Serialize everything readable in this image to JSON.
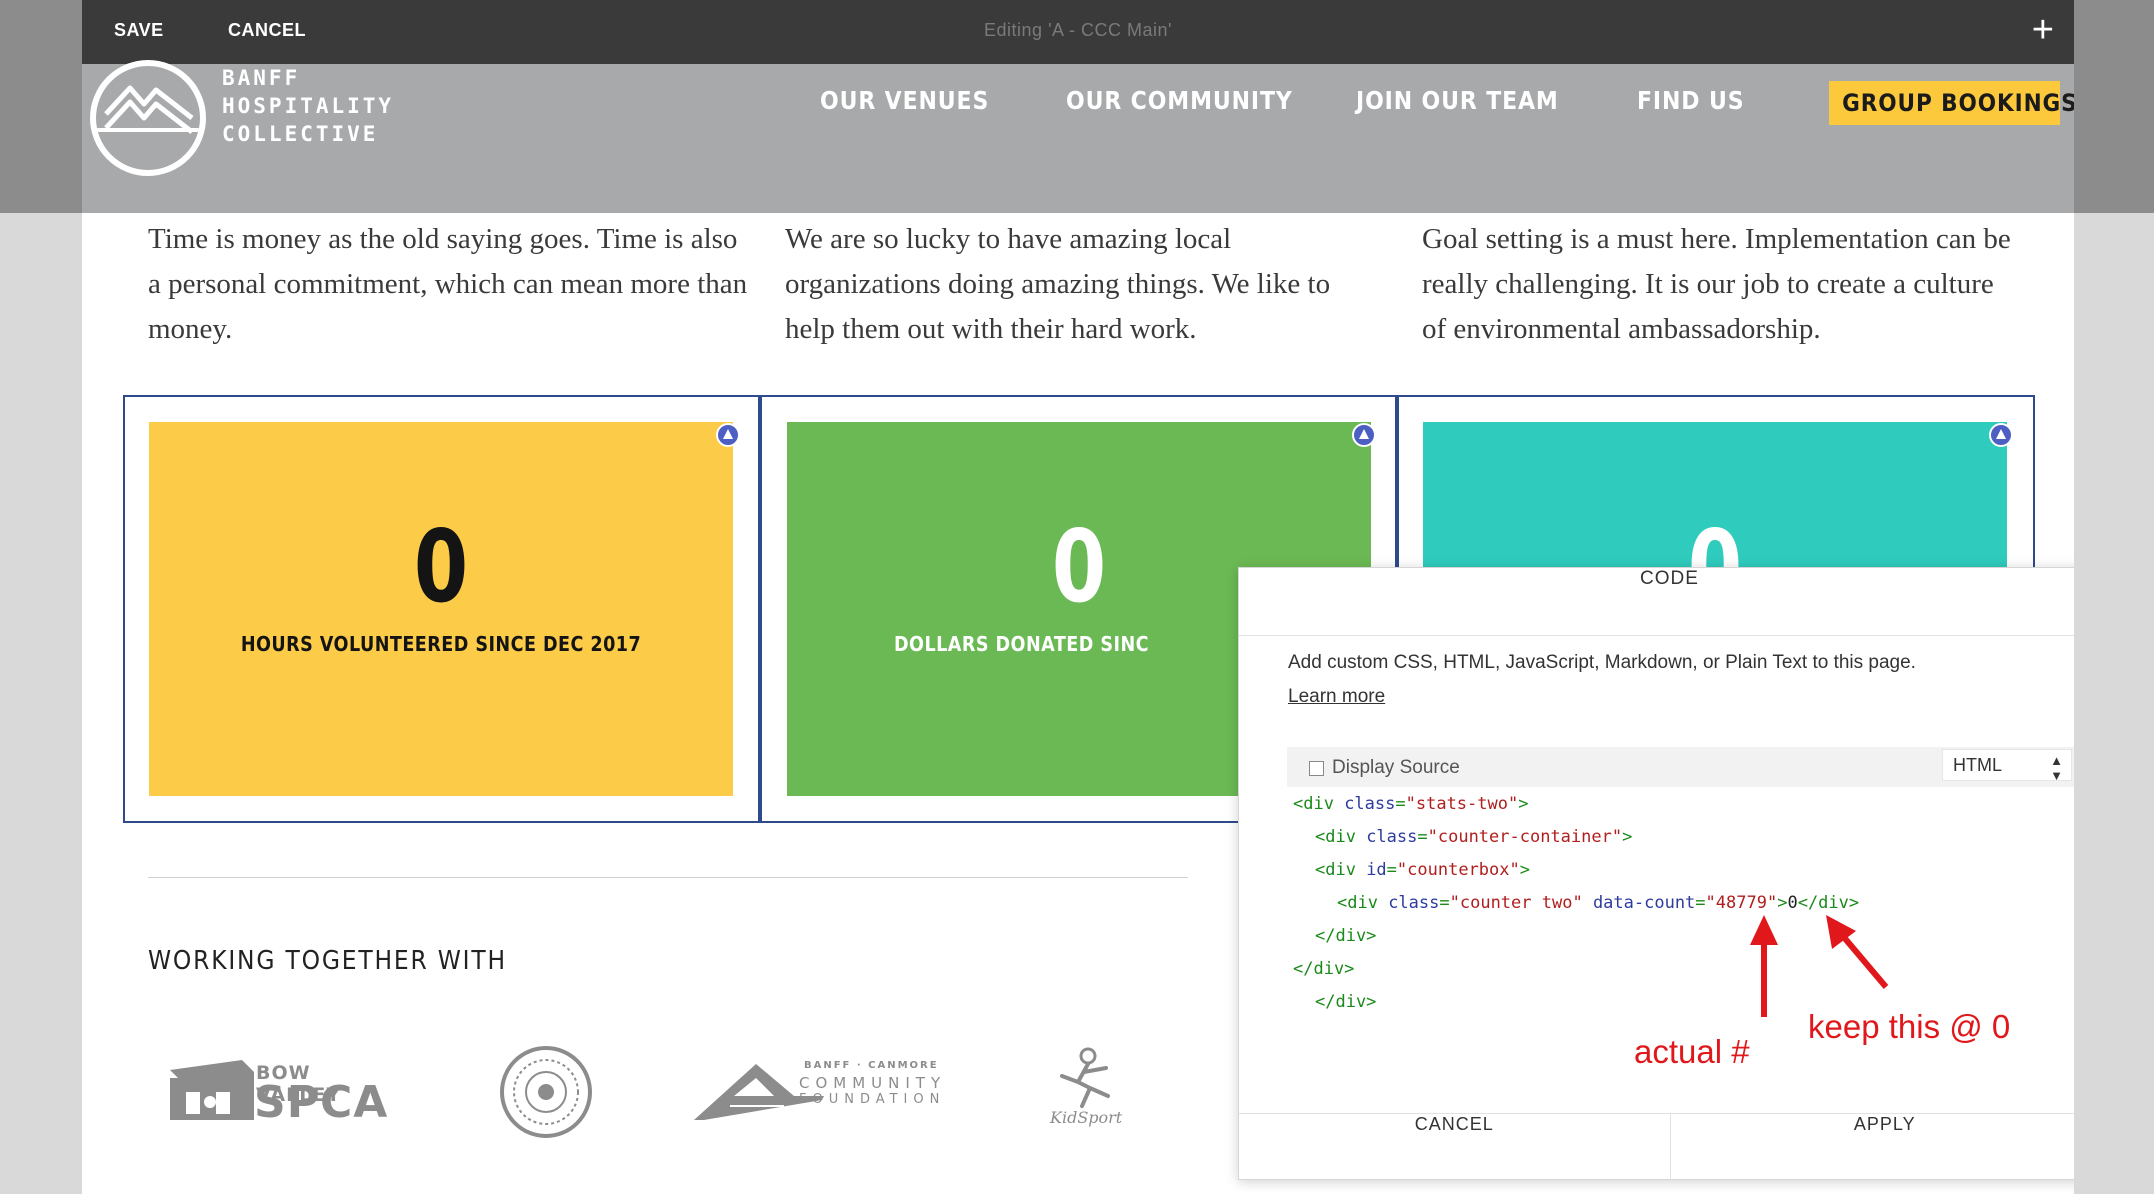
{
  "editor": {
    "save": "SAVE",
    "cancel": "CANCEL",
    "title": "Editing 'A - CCC Main'",
    "add": "+"
  },
  "site": {
    "logo_lines": [
      "BANFF",
      "HOSPITALITY",
      "COLLECTIVE"
    ],
    "nav": [
      "OUR VENUES",
      "OUR COMMUNITY",
      "JOIN OUR TEAM",
      "FIND US"
    ],
    "cta": "GROUP BOOKINGS"
  },
  "columns": [
    "Time is money as the old saying goes. Time is also a personal commitment, which can mean more than money.",
    "We are so lucky to have amazing local organizations doing amazing things. We like to help them out with their hard work.",
    "Goal setting is a must here. Implementation can be really challenging. It is our job to create a culture of environmental ambassadorship."
  ],
  "stats": [
    {
      "value": "0",
      "label": "HOURS VOLUNTEERED SINCE DEC 2017",
      "color": "#fccb47"
    },
    {
      "value": "0",
      "label": "DOLLARS DONATED SINC",
      "color": "#6bb954"
    },
    {
      "value": "0",
      "label": "",
      "color": "#2fcbbd"
    }
  ],
  "partners": {
    "title": "WORKING TOGETHER WITH",
    "spca": [
      "BOW VALLEY",
      "SPCA"
    ],
    "foundation": [
      "BANFF · CANMORE",
      "COMMUNITY",
      "FOUNDATION"
    ],
    "kidsport": "KidSport"
  },
  "dialog": {
    "title": "CODE",
    "description": "Add custom CSS, HTML, JavaScript, Markdown, or Plain Text to this page.",
    "learn_more": "Learn more",
    "display_source": "Display Source",
    "language": "HTML",
    "cancel": "CANCEL",
    "apply": "APPLY",
    "code": {
      "l1_class": "\"stats-two\"",
      "l2_class": "\"counter-container\"",
      "l3_id": "\"counterbox\"",
      "l4_class": "\"counter two\"",
      "l4_count": "\"48779\"",
      "l4_text": "0"
    }
  },
  "annotations": {
    "actual": "actual #",
    "keep": "keep this @ 0"
  }
}
